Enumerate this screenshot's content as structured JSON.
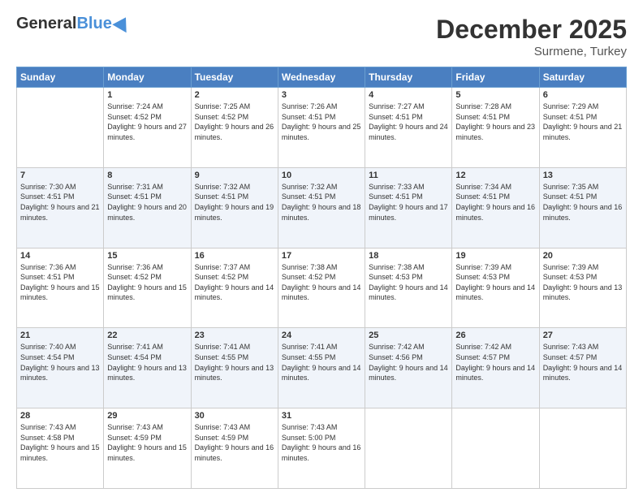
{
  "logo": {
    "general": "General",
    "blue": "Blue"
  },
  "header": {
    "month_year": "December 2025",
    "location": "Surmene, Turkey"
  },
  "days_of_week": [
    "Sunday",
    "Monday",
    "Tuesday",
    "Wednesday",
    "Thursday",
    "Friday",
    "Saturday"
  ],
  "weeks": [
    [
      {
        "day": "",
        "sunrise": "",
        "sunset": "",
        "daylight": ""
      },
      {
        "day": "1",
        "sunrise": "Sunrise: 7:24 AM",
        "sunset": "Sunset: 4:52 PM",
        "daylight": "Daylight: 9 hours and 27 minutes."
      },
      {
        "day": "2",
        "sunrise": "Sunrise: 7:25 AM",
        "sunset": "Sunset: 4:52 PM",
        "daylight": "Daylight: 9 hours and 26 minutes."
      },
      {
        "day": "3",
        "sunrise": "Sunrise: 7:26 AM",
        "sunset": "Sunset: 4:51 PM",
        "daylight": "Daylight: 9 hours and 25 minutes."
      },
      {
        "day": "4",
        "sunrise": "Sunrise: 7:27 AM",
        "sunset": "Sunset: 4:51 PM",
        "daylight": "Daylight: 9 hours and 24 minutes."
      },
      {
        "day": "5",
        "sunrise": "Sunrise: 7:28 AM",
        "sunset": "Sunset: 4:51 PM",
        "daylight": "Daylight: 9 hours and 23 minutes."
      },
      {
        "day": "6",
        "sunrise": "Sunrise: 7:29 AM",
        "sunset": "Sunset: 4:51 PM",
        "daylight": "Daylight: 9 hours and 21 minutes."
      }
    ],
    [
      {
        "day": "7",
        "sunrise": "Sunrise: 7:30 AM",
        "sunset": "Sunset: 4:51 PM",
        "daylight": "Daylight: 9 hours and 21 minutes."
      },
      {
        "day": "8",
        "sunrise": "Sunrise: 7:31 AM",
        "sunset": "Sunset: 4:51 PM",
        "daylight": "Daylight: 9 hours and 20 minutes."
      },
      {
        "day": "9",
        "sunrise": "Sunrise: 7:32 AM",
        "sunset": "Sunset: 4:51 PM",
        "daylight": "Daylight: 9 hours and 19 minutes."
      },
      {
        "day": "10",
        "sunrise": "Sunrise: 7:32 AM",
        "sunset": "Sunset: 4:51 PM",
        "daylight": "Daylight: 9 hours and 18 minutes."
      },
      {
        "day": "11",
        "sunrise": "Sunrise: 7:33 AM",
        "sunset": "Sunset: 4:51 PM",
        "daylight": "Daylight: 9 hours and 17 minutes."
      },
      {
        "day": "12",
        "sunrise": "Sunrise: 7:34 AM",
        "sunset": "Sunset: 4:51 PM",
        "daylight": "Daylight: 9 hours and 16 minutes."
      },
      {
        "day": "13",
        "sunrise": "Sunrise: 7:35 AM",
        "sunset": "Sunset: 4:51 PM",
        "daylight": "Daylight: 9 hours and 16 minutes."
      }
    ],
    [
      {
        "day": "14",
        "sunrise": "Sunrise: 7:36 AM",
        "sunset": "Sunset: 4:51 PM",
        "daylight": "Daylight: 9 hours and 15 minutes."
      },
      {
        "day": "15",
        "sunrise": "Sunrise: 7:36 AM",
        "sunset": "Sunset: 4:52 PM",
        "daylight": "Daylight: 9 hours and 15 minutes."
      },
      {
        "day": "16",
        "sunrise": "Sunrise: 7:37 AM",
        "sunset": "Sunset: 4:52 PM",
        "daylight": "Daylight: 9 hours and 14 minutes."
      },
      {
        "day": "17",
        "sunrise": "Sunrise: 7:38 AM",
        "sunset": "Sunset: 4:52 PM",
        "daylight": "Daylight: 9 hours and 14 minutes."
      },
      {
        "day": "18",
        "sunrise": "Sunrise: 7:38 AM",
        "sunset": "Sunset: 4:53 PM",
        "daylight": "Daylight: 9 hours and 14 minutes."
      },
      {
        "day": "19",
        "sunrise": "Sunrise: 7:39 AM",
        "sunset": "Sunset: 4:53 PM",
        "daylight": "Daylight: 9 hours and 14 minutes."
      },
      {
        "day": "20",
        "sunrise": "Sunrise: 7:39 AM",
        "sunset": "Sunset: 4:53 PM",
        "daylight": "Daylight: 9 hours and 13 minutes."
      }
    ],
    [
      {
        "day": "21",
        "sunrise": "Sunrise: 7:40 AM",
        "sunset": "Sunset: 4:54 PM",
        "daylight": "Daylight: 9 hours and 13 minutes."
      },
      {
        "day": "22",
        "sunrise": "Sunrise: 7:41 AM",
        "sunset": "Sunset: 4:54 PM",
        "daylight": "Daylight: 9 hours and 13 minutes."
      },
      {
        "day": "23",
        "sunrise": "Sunrise: 7:41 AM",
        "sunset": "Sunset: 4:55 PM",
        "daylight": "Daylight: 9 hours and 13 minutes."
      },
      {
        "day": "24",
        "sunrise": "Sunrise: 7:41 AM",
        "sunset": "Sunset: 4:55 PM",
        "daylight": "Daylight: 9 hours and 14 minutes."
      },
      {
        "day": "25",
        "sunrise": "Sunrise: 7:42 AM",
        "sunset": "Sunset: 4:56 PM",
        "daylight": "Daylight: 9 hours and 14 minutes."
      },
      {
        "day": "26",
        "sunrise": "Sunrise: 7:42 AM",
        "sunset": "Sunset: 4:57 PM",
        "daylight": "Daylight: 9 hours and 14 minutes."
      },
      {
        "day": "27",
        "sunrise": "Sunrise: 7:43 AM",
        "sunset": "Sunset: 4:57 PM",
        "daylight": "Daylight: 9 hours and 14 minutes."
      }
    ],
    [
      {
        "day": "28",
        "sunrise": "Sunrise: 7:43 AM",
        "sunset": "Sunset: 4:58 PM",
        "daylight": "Daylight: 9 hours and 15 minutes."
      },
      {
        "day": "29",
        "sunrise": "Sunrise: 7:43 AM",
        "sunset": "Sunset: 4:59 PM",
        "daylight": "Daylight: 9 hours and 15 minutes."
      },
      {
        "day": "30",
        "sunrise": "Sunrise: 7:43 AM",
        "sunset": "Sunset: 4:59 PM",
        "daylight": "Daylight: 9 hours and 16 minutes."
      },
      {
        "day": "31",
        "sunrise": "Sunrise: 7:43 AM",
        "sunset": "Sunset: 5:00 PM",
        "daylight": "Daylight: 9 hours and 16 minutes."
      },
      {
        "day": "",
        "sunrise": "",
        "sunset": "",
        "daylight": ""
      },
      {
        "day": "",
        "sunrise": "",
        "sunset": "",
        "daylight": ""
      },
      {
        "day": "",
        "sunrise": "",
        "sunset": "",
        "daylight": ""
      }
    ]
  ]
}
